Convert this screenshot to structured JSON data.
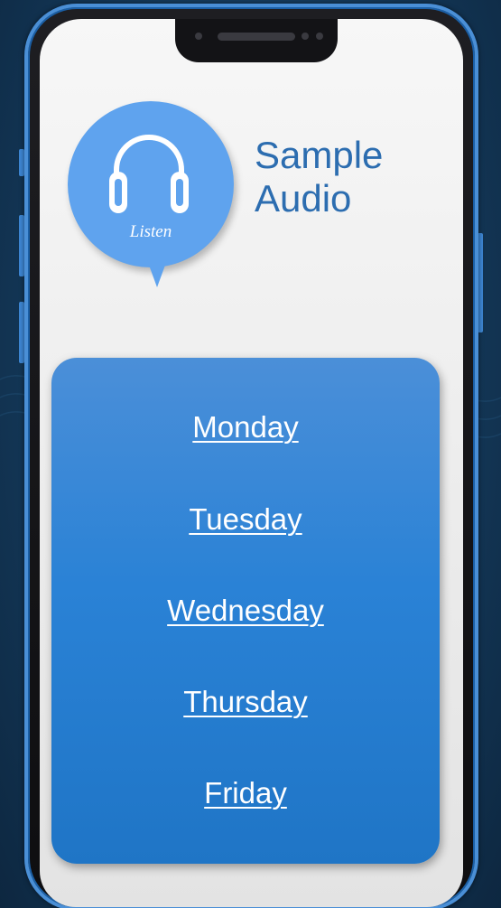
{
  "header": {
    "listen_label": "Listen",
    "title_line1": "Sample",
    "title_line2": "Audio"
  },
  "days": [
    {
      "label": "Monday"
    },
    {
      "label": "Tuesday"
    },
    {
      "label": "Wednesday"
    },
    {
      "label": "Thursday"
    },
    {
      "label": "Friday"
    }
  ],
  "colors": {
    "accent_blue": "#5fa3ee",
    "title_blue": "#2c6db0",
    "card_blue": "#2a82d6",
    "phone_frame": "#4a8fd6",
    "background": "#14395a"
  },
  "icons": {
    "listen": "headphones-icon"
  }
}
